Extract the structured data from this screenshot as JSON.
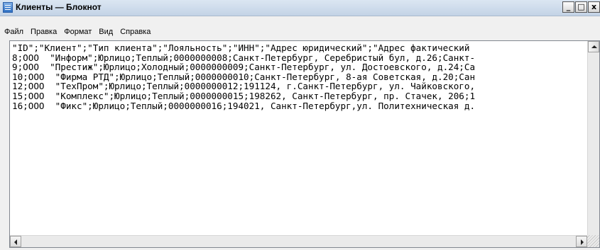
{
  "window": {
    "title": "Клиенты — Блокнот",
    "buttons": {
      "minimize": "_",
      "maximize": "□",
      "close": "x"
    }
  },
  "menu": [
    "Файл",
    "Правка",
    "Формат",
    "Вид",
    "Справка"
  ],
  "document": {
    "lines": [
      "\"ID\";\"Клиент\";\"Тип клиента\";\"Лояльность\";\"ИНН\";\"Адрес юридический\";\"Адрес фактический",
      "8;ООО  \"Информ\";Юрлицо;Теплый;0000000008;Санкт-Петербург, Серебристый бул, д.26;Санкт-",
      "9;ООО  \"Престиж\";Юрлицо;Холодный;0000000009;Санкт-Петербург, ул. Достоевского, д.24;Са",
      "10;ООО  \"Фирма РТД\";Юрлицо;Теплый;0000000010;Санкт-Петербург, 8-ая Советская, д.20;Сан",
      "12;ООО  \"ТехПром\";Юрлицо;Теплый;0000000012;191124, г.Санкт-Петербург, ул. Чайковского,",
      "15;ООО  \"Комплекс\";Юрлицо;Теплый;0000000015;198262, Санкт-Петербург, пр. Стачек, 206;1",
      "16;ООО  \"Фикс\";Юрлицо;Теплый;0000000016;194021, Санкт-Петербург,ул. Политехническая д."
    ]
  }
}
